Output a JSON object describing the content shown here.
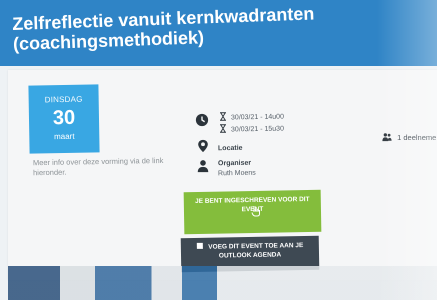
{
  "header": {
    "title": "Zelfreflectie vanuit kernkwadranten\n(coachingsmethodiek)"
  },
  "event": {
    "date": {
      "day_name": "DINSDAG",
      "day_number": "30",
      "month": "maart"
    },
    "more_info_text": "Meer info over deze vorming via de link hieronder.",
    "time": {
      "start": "30/03/21 - 14u00",
      "end": "30/03/21 - 15u30"
    },
    "location_label": "Locatie",
    "organiser": {
      "label": "Organiser",
      "name": "Ruth Moens"
    },
    "participants": "1 deelneme",
    "register_button_label": "JE BENT INGESCHREVEN VOOR DIT EVENT",
    "outlook_button_label": "VOEG DIT EVENT TOE AAN JE OUTLOOK AGENDA"
  },
  "icons": {
    "clock": "clock-icon",
    "hourglass": "hourglass-icon",
    "location": "map-pin-icon",
    "person": "user-icon",
    "participants": "users-icon",
    "calendar": "calendar-icon",
    "cursor": "hand-pointer-icon"
  },
  "colors": {
    "header": "#2f84c6",
    "date_box": "#39a7e3",
    "register_button": "#84bd3c",
    "outlook_button": "#3e4953"
  }
}
